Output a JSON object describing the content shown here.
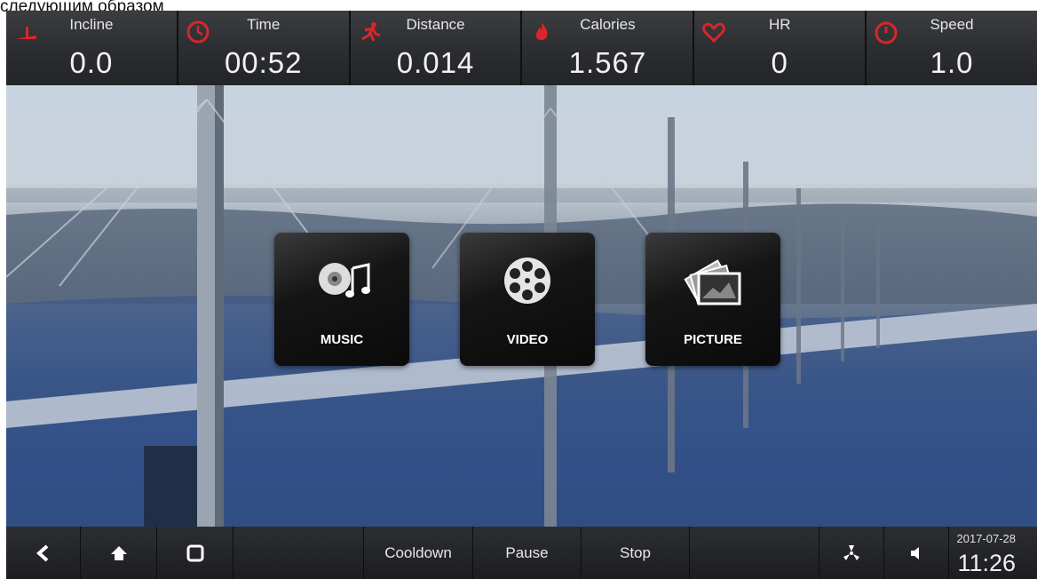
{
  "caption": "следующим образом",
  "stats": [
    {
      "label": "Incline",
      "value": "0.0",
      "icon": "incline-icon"
    },
    {
      "label": "Time",
      "value": "00:52",
      "icon": "clock-icon"
    },
    {
      "label": "Distance",
      "value": "0.014",
      "icon": "runner-icon"
    },
    {
      "label": "Calories",
      "value": "1.567",
      "icon": "flame-icon"
    },
    {
      "label": "HR",
      "value": "0",
      "icon": "heart-icon"
    },
    {
      "label": "Speed",
      "value": "1.0",
      "icon": "speedometer-icon"
    }
  ],
  "media": {
    "music": "MUSIC",
    "video": "VIDEO",
    "picture": "PICTURE"
  },
  "bottom": {
    "cooldown": "Cooldown",
    "pause": "Pause",
    "stop": "Stop",
    "date": "2017-07-28",
    "time": "11:26"
  },
  "colors": {
    "icon_red": "#d8262a",
    "bar_dark": "#2a2c2f"
  }
}
